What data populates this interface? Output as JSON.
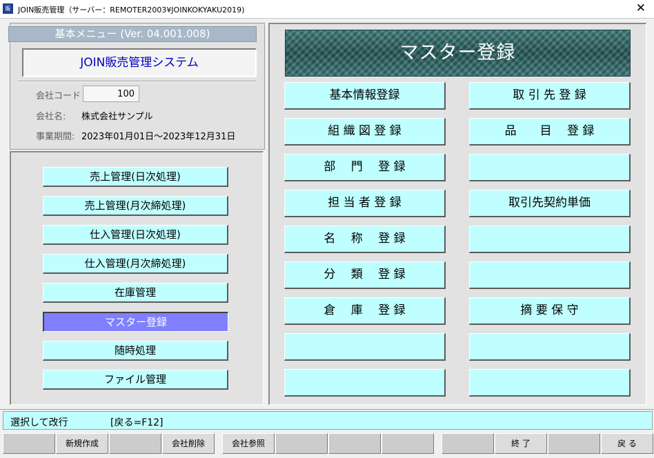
{
  "window": {
    "title": "JOIN販売管理（サーバー：REMOTER2003¥JOINKOKYAKU2019)",
    "app_icon_text": "販",
    "close_glyph": "✕"
  },
  "menu_header": "基本メニュー (Ver. 04.001.008)",
  "system_name": "JOIN販売管理システム",
  "company": {
    "code_label": "会社コード",
    "code_value": "100",
    "name_label": "会社名:",
    "name_value": "株式会社サンプル",
    "period_label": "事業期間:",
    "period_value": "2023年01月01日～2023年12月31日"
  },
  "left_menu": [
    "売上管理(日次処理)",
    "売上管理(月次締処理)",
    "仕入管理(日次処理)",
    "仕入管理(月次締処理)",
    "在庫管理",
    "マスター登録",
    "随時処理",
    "ファイル管理"
  ],
  "left_menu_active_index": 5,
  "master_title": "マスター登録",
  "master_buttons": {
    "col1": [
      "基本情報登録",
      "組 織 図 登 録",
      "部　 門　 登 録",
      "担 当 者 登 録",
      "名　 称　 登 録",
      "分　 類　 登 録",
      "倉　 庫　 登 録",
      "",
      ""
    ],
    "col2": [
      "取 引 先 登 録",
      "品　　目　 登 録",
      "",
      "取引先契約単価",
      "",
      "",
      "摘 要 保 守",
      "",
      ""
    ]
  },
  "status_bar": {
    "left": "選択して改行",
    "hint": "[戻る=F12]"
  },
  "function_keys": [
    "",
    "新規作成",
    "",
    "会社削除",
    "会社参照",
    "",
    "",
    "",
    "",
    "終 了",
    "",
    "戻 る"
  ],
  "colors": {
    "button_bg": "#c0ffff",
    "active_menu_bg": "#8080ff",
    "system_name_text": "#0000c0",
    "header_bg": "#a8b8c8"
  }
}
